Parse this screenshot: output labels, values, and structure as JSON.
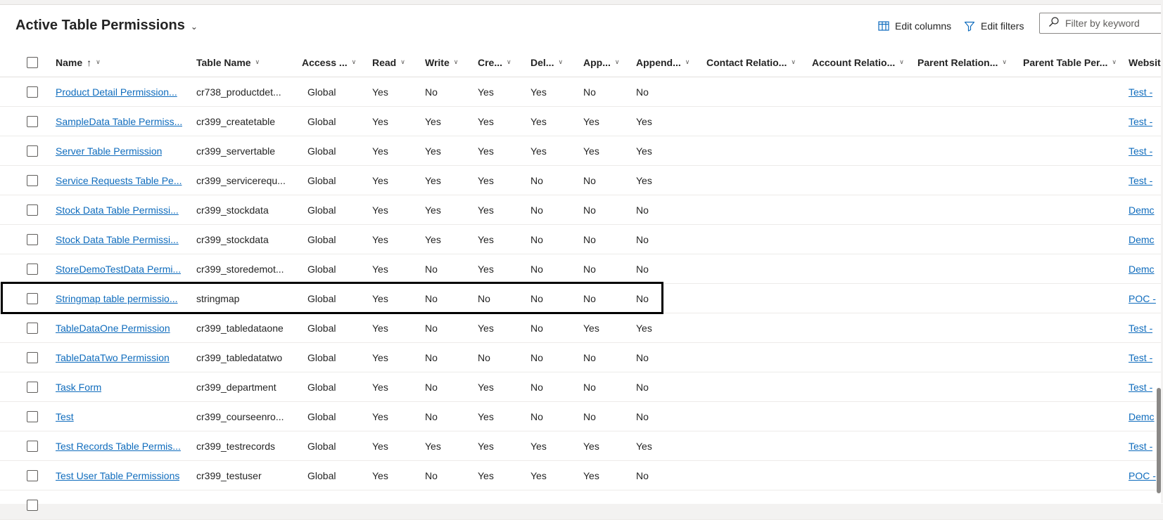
{
  "view": {
    "title": "Active Table Permissions",
    "edit_columns": "Edit columns",
    "edit_filters": "Edit filters",
    "filter_placeholder": "Filter by keyword"
  },
  "columns": [
    {
      "key": "name",
      "label": "Name",
      "sort": "ascending"
    },
    {
      "key": "table",
      "label": "Table Name"
    },
    {
      "key": "access",
      "label": "Access ..."
    },
    {
      "key": "read",
      "label": "Read"
    },
    {
      "key": "write",
      "label": "Write"
    },
    {
      "key": "create",
      "label": "Cre..."
    },
    {
      "key": "delete",
      "label": "Del..."
    },
    {
      "key": "append",
      "label": "App..."
    },
    {
      "key": "appendto",
      "label": "Append..."
    },
    {
      "key": "contact",
      "label": "Contact Relatio..."
    },
    {
      "key": "account",
      "label": "Account Relatio..."
    },
    {
      "key": "parent",
      "label": "Parent Relation..."
    },
    {
      "key": "parenttable",
      "label": "Parent Table Per..."
    },
    {
      "key": "website",
      "label": "Website"
    }
  ],
  "rows": [
    {
      "name": "Product Detail Permission...",
      "table": "cr738_productdet...",
      "access": "Global",
      "read": "Yes",
      "write": "No",
      "create": "Yes",
      "delete": "Yes",
      "append": "No",
      "appendto": "No",
      "website": "Test -"
    },
    {
      "name": "SampleData Table Permiss...",
      "table": "cr399_createtable",
      "access": "Global",
      "read": "Yes",
      "write": "Yes",
      "create": "Yes",
      "delete": "Yes",
      "append": "Yes",
      "appendto": "Yes",
      "website": "Test -"
    },
    {
      "name": "Server Table Permission",
      "table": "cr399_servertable",
      "access": "Global",
      "read": "Yes",
      "write": "Yes",
      "create": "Yes",
      "delete": "Yes",
      "append": "Yes",
      "appendto": "Yes",
      "website": "Test -"
    },
    {
      "name": "Service Requests Table Pe...",
      "table": "cr399_servicerequ...",
      "access": "Global",
      "read": "Yes",
      "write": "Yes",
      "create": "Yes",
      "delete": "No",
      "append": "No",
      "appendto": "Yes",
      "website": "Test -"
    },
    {
      "name": "Stock Data Table Permissi...",
      "table": "cr399_stockdata",
      "access": "Global",
      "read": "Yes",
      "write": "Yes",
      "create": "Yes",
      "delete": "No",
      "append": "No",
      "appendto": "No",
      "website": "Demc"
    },
    {
      "name": "Stock Data Table Permissi...",
      "table": "cr399_stockdata",
      "access": "Global",
      "read": "Yes",
      "write": "Yes",
      "create": "Yes",
      "delete": "No",
      "append": "No",
      "appendto": "No",
      "website": "Demc"
    },
    {
      "name": "StoreDemoTestData Permi...",
      "table": "cr399_storedemot...",
      "access": "Global",
      "read": "Yes",
      "write": "No",
      "create": "Yes",
      "delete": "No",
      "append": "No",
      "appendto": "No",
      "website": "Demc"
    },
    {
      "name": "Stringmap table permissio...",
      "table": "stringmap",
      "access": "Global",
      "read": "Yes",
      "write": "No",
      "create": "No",
      "delete": "No",
      "append": "No",
      "appendto": "No",
      "website": "POC -"
    },
    {
      "name": "TableDataOne Permission",
      "table": "cr399_tabledataone",
      "access": "Global",
      "read": "Yes",
      "write": "No",
      "create": "Yes",
      "delete": "No",
      "append": "Yes",
      "appendto": "Yes",
      "website": "Test -"
    },
    {
      "name": "TableDataTwo Permission",
      "table": "cr399_tabledatatwo",
      "access": "Global",
      "read": "Yes",
      "write": "No",
      "create": "No",
      "delete": "No",
      "append": "No",
      "appendto": "No",
      "website": "Test -"
    },
    {
      "name": "Task Form",
      "table": "cr399_department",
      "access": "Global",
      "read": "Yes",
      "write": "No",
      "create": "Yes",
      "delete": "No",
      "append": "No",
      "appendto": "No",
      "website": "Test -"
    },
    {
      "name": "Test",
      "table": "cr399_courseenro...",
      "access": "Global",
      "read": "Yes",
      "write": "No",
      "create": "Yes",
      "delete": "No",
      "append": "No",
      "appendto": "No",
      "website": "Demc"
    },
    {
      "name": "Test Records Table Permis...",
      "table": "cr399_testrecords",
      "access": "Global",
      "read": "Yes",
      "write": "Yes",
      "create": "Yes",
      "delete": "Yes",
      "append": "Yes",
      "appendto": "Yes",
      "website": "Test -"
    },
    {
      "name": "Test User Table Permissions",
      "table": "cr399_testuser",
      "access": "Global",
      "read": "Yes",
      "write": "No",
      "create": "Yes",
      "delete": "Yes",
      "append": "Yes",
      "appendto": "No",
      "website": "POC -"
    }
  ],
  "selected_row_index": 7,
  "colors": {
    "link": "#0f6cbd",
    "highlight_border": "#000000"
  }
}
